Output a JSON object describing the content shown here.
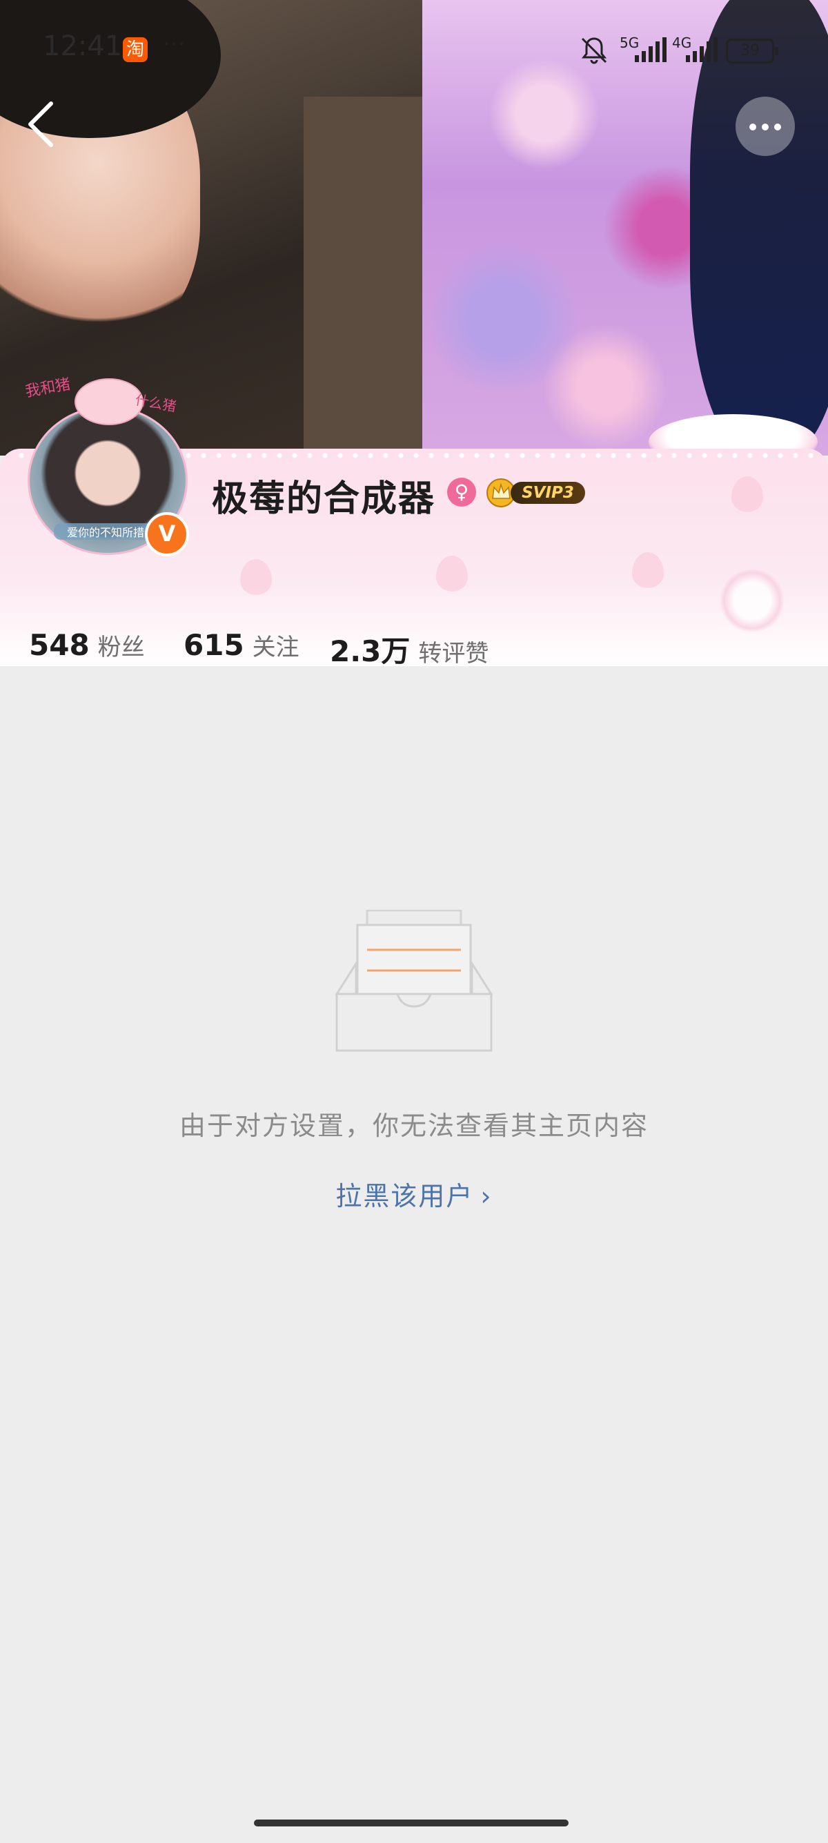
{
  "status_bar": {
    "time": "12:41",
    "app_icon_glyph": "淘",
    "overflow": "···",
    "network1": "5G",
    "network2": "4G",
    "battery": "39"
  },
  "profile": {
    "username": "极莓的合成器",
    "gender_icon": "female-icon",
    "vip_label": "SVIP3",
    "verified_glyph": "V",
    "avatar_deco_left": "我和猪",
    "avatar_deco_right": "什么猪",
    "avatar_caption": "爱你的不知所措",
    "stats": [
      {
        "value": "548",
        "label": "粉丝"
      },
      {
        "value": "615",
        "label": "关注"
      },
      {
        "value": "2.3万",
        "label": "转评赞"
      }
    ]
  },
  "empty_state": {
    "message": "由于对方设置，你无法查看其主页内容",
    "block_link": "拉黑该用户",
    "block_chevron": "›"
  },
  "colors": {
    "accent_orange": "#f7731c",
    "link_blue": "#4d74a8",
    "card_pink": "#fde0ec"
  }
}
